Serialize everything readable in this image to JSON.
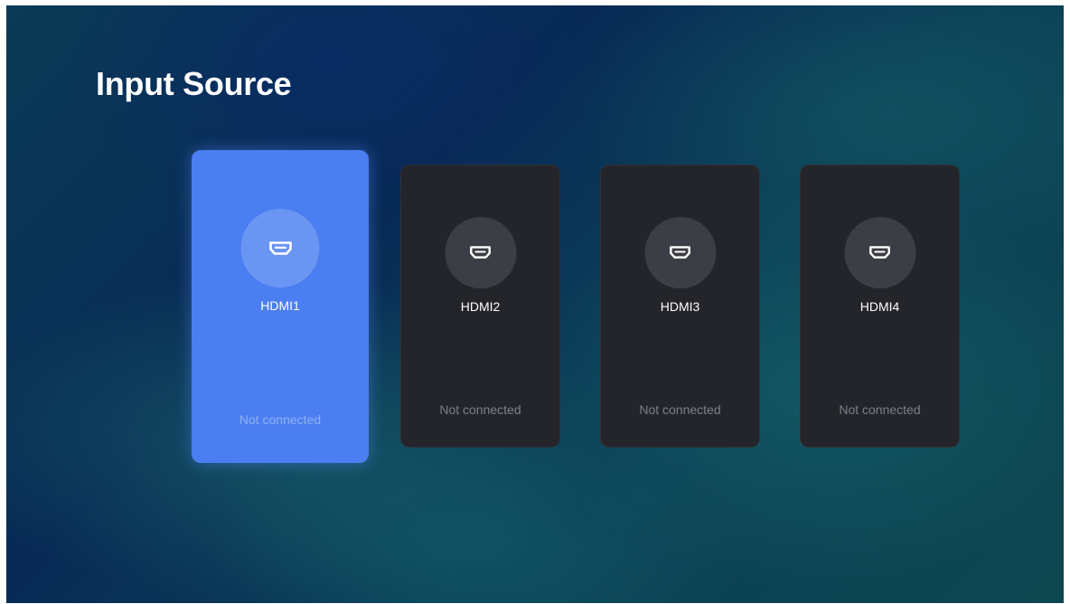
{
  "page": {
    "title": "Input Source"
  },
  "sources": [
    {
      "label": "HDMI1",
      "status": "Not connected",
      "selected": true,
      "icon": "hdmi-port-icon"
    },
    {
      "label": "HDMI2",
      "status": "Not connected",
      "selected": false,
      "icon": "hdmi-port-icon"
    },
    {
      "label": "HDMI3",
      "status": "Not connected",
      "selected": false,
      "icon": "hdmi-port-icon"
    },
    {
      "label": "HDMI4",
      "status": "Not connected",
      "selected": false,
      "icon": "hdmi-port-icon"
    }
  ],
  "colors": {
    "selected_card": "#4b7ef0",
    "card": "#23252a",
    "icon_circle": "#3c3e45",
    "status_text": "#7d8088"
  }
}
